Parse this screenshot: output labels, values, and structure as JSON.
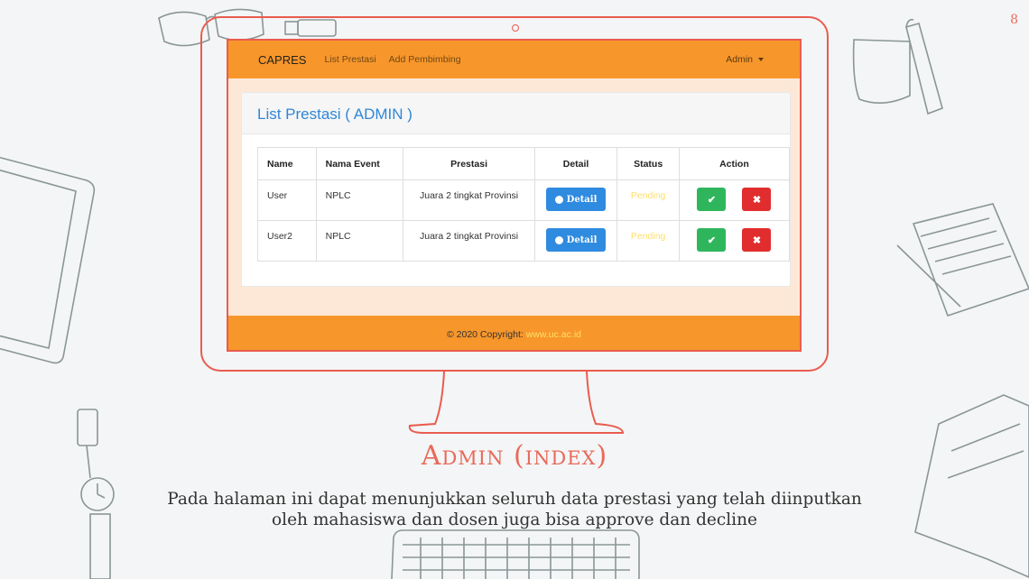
{
  "page_number": "8",
  "navbar": {
    "brand": "CAPRES",
    "links": [
      "List Prestasi",
      "Add Pembimbing"
    ],
    "user_menu": "Admin"
  },
  "card": {
    "title": "List Prestasi ( ADMIN )"
  },
  "table": {
    "headers": [
      "Name",
      "Nama Event",
      "Prestasi",
      "Detail",
      "Status",
      "Action"
    ],
    "rows": [
      {
        "name": "User",
        "event": "NPLC",
        "prestasi": "Juara 2 tingkat Provinsi",
        "detail": "Detail",
        "status": "Pending"
      },
      {
        "name": "User2",
        "event": "NPLC",
        "prestasi": "Juara 2 tingkat Provinsi",
        "detail": "Detail",
        "status": "Pending"
      }
    ]
  },
  "footer": {
    "text": "© 2020 Copyright:",
    "link": "www.uc.ac.id"
  },
  "slide": {
    "title": "Admin (index)",
    "description_line1": "Pada halaman ini dapat menunjukkan seluruh data prestasi yang telah diinputkan",
    "description_line2": "oleh mahasiswa dan dosen juga bisa approve dan decline"
  },
  "colors": {
    "accent": "#f7962b",
    "frame": "#e95c4f",
    "title": "#2f86d6",
    "pending": "#ffe066"
  }
}
